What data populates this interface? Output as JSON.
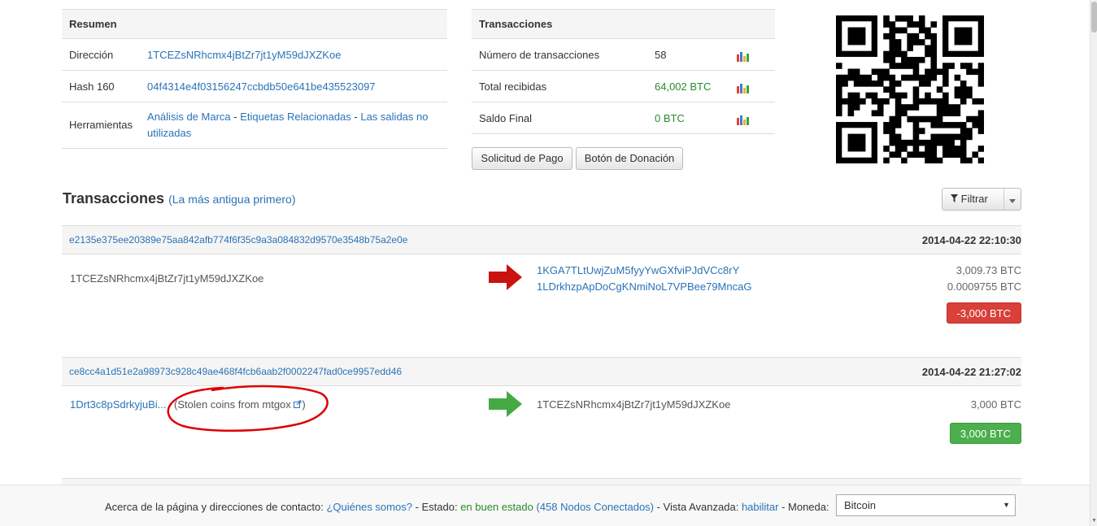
{
  "summary": {
    "header": "Resumen",
    "address_label": "Dirección",
    "address": "1TCEZsNRhcmx4jBtZr7jt1yM59dJXZKoe",
    "hash160_label": "Hash 160",
    "hash160": "04f4314e4f03156247ccbdb50e641be435523097",
    "tools_label": "Herramientas",
    "tools": {
      "brand_analysis": "Análisis de Marca",
      "sep1": " - ",
      "related_tags": "Etiquetas Relacionadas",
      "sep2": " - ",
      "unspent_outputs": "Las salidas no utilizadas"
    }
  },
  "stats": {
    "header": "Transacciones",
    "num_tx_label": "Número de transacciones",
    "num_tx": "58",
    "total_received_label": "Total recibidas",
    "total_received": "64,002 BTC",
    "final_balance_label": "Saldo Final",
    "final_balance": "0 BTC",
    "chart_icon": "bar-chart-icon"
  },
  "buttons": {
    "payment_request": "Solicitud de Pago",
    "donation_button": "Botón de Donación"
  },
  "transactions_section": {
    "title": "Transacciones",
    "order": "(La más antigua primero)",
    "filter_label": "Filtrar",
    "filter_icon": "funnel-icon"
  },
  "transactions": [
    {
      "hash": "e2135e375ee20389e75aa842afb774f6f35c9a3a084832d9570e3548b75a2e0e",
      "date": "2014-04-22 22:10:30",
      "from": "1TCEZsNRhcmx4jBtZr7jt1yM59dJXZKoe",
      "direction": "out",
      "arrow_color": "#cc1111",
      "outputs": [
        {
          "address": "1KGA7TLtUwjZuM5fyyYwGXfviPJdVCc8rY",
          "amount": "3,009.73 BTC"
        },
        {
          "address": "1LDrkhzpApDoCgKNmiNoL7VPBee79MncaG",
          "amount": "0.0009755 BTC"
        }
      ],
      "total": "-3,000 BTC"
    },
    {
      "hash": "ce8cc4a1d51e2a98973c928c49ae468f4fcb6aab2f0002247fad0ce9957edd46",
      "date": "2014-04-22 21:27:02",
      "from": "1Drt3c8pSdrkyjuBi...",
      "from_note": "(Stolen coins from mtgox",
      "from_note_end": ")",
      "direction": "in",
      "arrow_color": "#44aa44",
      "outputs": [
        {
          "address": "1TCEZsNRhcmx4jBtZr7jt1yM59dJXZKoe",
          "amount": "3,000 BTC"
        }
      ],
      "total": "3,000 BTC"
    }
  ],
  "footer": {
    "about": "Acerca de la página y direcciones de contacto: ",
    "who_we_are": "¿Quiénes somos?",
    "status_label": " - Estado: ",
    "status": "en buen estado",
    "nodes": "(458 Nodos Conectados)",
    "advanced_label": " - Vista Avanzada: ",
    "enable": "habilitar",
    "currency_label": " - Moneda: ",
    "currency": "Bitcoin"
  },
  "colors": {
    "link": "#2a73b7",
    "badge_red": "#d9403a",
    "badge_green": "#4cae4c",
    "annotation": "#dd0000"
  }
}
